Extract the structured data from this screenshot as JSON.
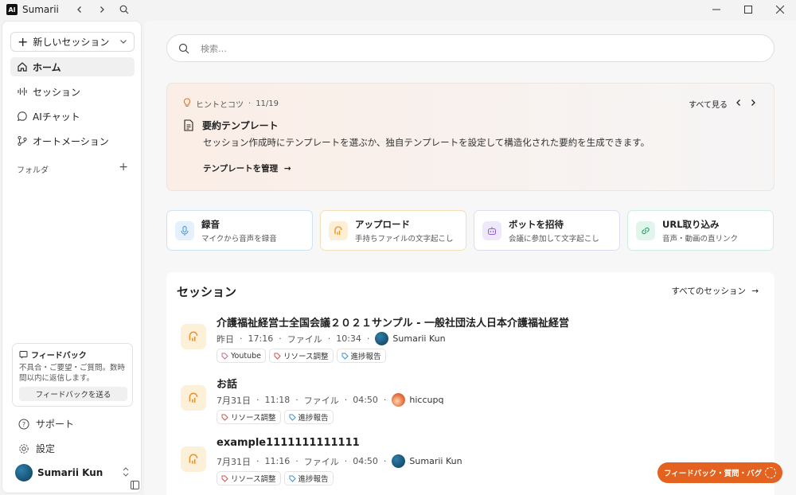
{
  "app": {
    "title": "Sumarii",
    "logo_text": "Al"
  },
  "sidebar": {
    "new_session_label": "新しいセッション",
    "nav": [
      {
        "label": "ホーム",
        "icon": "home-icon"
      },
      {
        "label": "セッション",
        "icon": "waveform-icon"
      },
      {
        "label": "AIチャット",
        "icon": "chat-icon"
      },
      {
        "label": "オートメーション",
        "icon": "automation-icon"
      }
    ],
    "folder_label": "フォルダ",
    "feedback": {
      "title": "フィードバック",
      "desc": "不具合・ご要望・ご質問。数時間以内に返信します。",
      "button": "フィードバックを送る"
    },
    "support_label": "サポート",
    "settings_label": "設定",
    "user_name": "Sumarii Kun"
  },
  "main": {
    "search_placeholder": "検索…",
    "tips": {
      "label": "ヒントとコツ",
      "counter": "11/19",
      "see_all": "すべて見る",
      "title": "要約テンプレート",
      "desc": "セッション作成時にテンプレートを選ぶか、独自テンプレートを設定して構造化された要約を生成できます。",
      "link": "テンプレートを管理"
    },
    "actions": [
      {
        "title": "録音",
        "sub": "マイクから音声を録音",
        "color": "#3f8fd8"
      },
      {
        "title": "アップロード",
        "sub": "手持ちファイルの文字起こし",
        "color": "#e7902b"
      },
      {
        "title": "ボットを招待",
        "sub": "会議に参加して文字起こし",
        "color": "#8b5fd6"
      },
      {
        "title": "URL取り込み",
        "sub": "音声・動画の直リンク",
        "color": "#2fa36b"
      }
    ],
    "sessions": {
      "title": "セッション",
      "see_all": "すべてのセッション",
      "items": [
        {
          "name": "介護福祉経営士全国会議２０２１サンプル - 一般社団法人日本介護福祉経営",
          "date": "昨日",
          "time": "17:16",
          "kind": "ファイル",
          "duration": "10:34",
          "user": "Sumarii Kun",
          "tags": [
            "Youtube",
            "リソース調整",
            "進捗報告"
          ]
        },
        {
          "name": "お話",
          "date": "7月31日",
          "time": "11:18",
          "kind": "ファイル",
          "duration": "04:50",
          "user": "hiccupq",
          "tags": [
            "リソース調整",
            "進捗報告"
          ]
        },
        {
          "name": "example1111111111111",
          "date": "7月31日",
          "time": "11:16",
          "kind": "ファイル",
          "duration": "04:50",
          "user": "Sumarii Kun",
          "tags": [
            "リソース調整",
            "進捗報告"
          ]
        }
      ]
    },
    "floating_feedback": "フィードバック・質問・バグ"
  }
}
